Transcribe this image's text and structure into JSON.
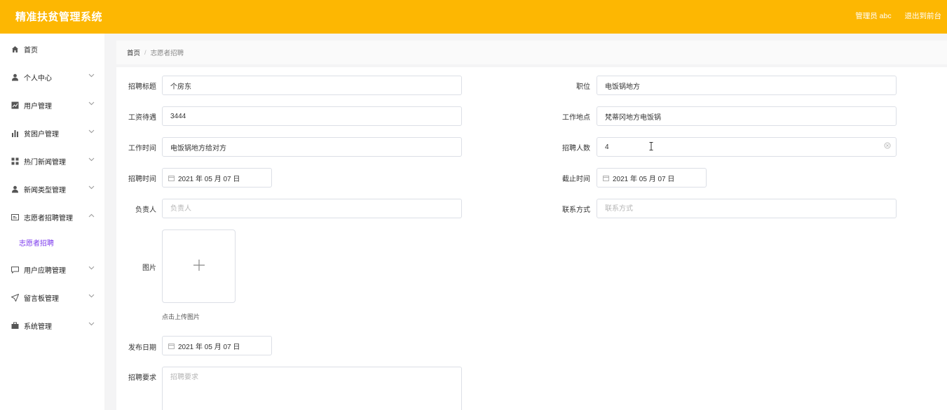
{
  "header": {
    "title": "精准扶贫管理系统",
    "user_label": "管理员 abc",
    "exit_label": "退出到前台"
  },
  "sidebar": {
    "items": [
      {
        "label": "首页",
        "icon": "home-icon"
      },
      {
        "label": "个人中心",
        "icon": "user-icon"
      },
      {
        "label": "用户管理",
        "icon": "chart-icon"
      },
      {
        "label": "贫困户管理",
        "icon": "bar-chart-icon"
      },
      {
        "label": "热门新闻管理",
        "icon": "grid-icon"
      },
      {
        "label": "新闻类型管理",
        "icon": "user-icon"
      },
      {
        "label": "志愿者招聘管理",
        "icon": "card-icon"
      },
      {
        "label": "用户应聘管理",
        "icon": "message-icon"
      },
      {
        "label": "留言板管理",
        "icon": "send-icon"
      },
      {
        "label": "系统管理",
        "icon": "briefcase-icon"
      }
    ],
    "sub_item": "志愿者招聘"
  },
  "breadcrumb": {
    "home": "首页",
    "separator": "/",
    "current": "志愿者招聘"
  },
  "form": {
    "title_label": "招聘标题",
    "title_value": "个房东",
    "position_label": "职位",
    "position_value": "电饭锅地方",
    "salary_label": "工资待遇",
    "salary_value": "3444",
    "location_label": "工作地点",
    "location_value": "梵蒂冈地方电饭锅",
    "worktime_label": "工作时间",
    "worktime_value": "电饭锅地方给对方",
    "count_label": "招聘人数",
    "count_value": "4",
    "recruit_time_label": "招聘时间",
    "recruit_time_value": "2021 年 05 月 07 日",
    "deadline_label": "截止时间",
    "deadline_value": "2021 年 05 月 07 日",
    "manager_label": "负责人",
    "manager_placeholder": "负责人",
    "contact_label": "联系方式",
    "contact_placeholder": "联系方式",
    "image_label": "图片",
    "upload_hint": "点击上传图片",
    "publish_label": "发布日期",
    "publish_value": "2021 年 05 月 07 日",
    "requirements_label": "招聘要求",
    "requirements_placeholder": "招聘要求"
  },
  "colors": {
    "header_bg": "#fdb702",
    "active_sub": "#7c3aed"
  }
}
